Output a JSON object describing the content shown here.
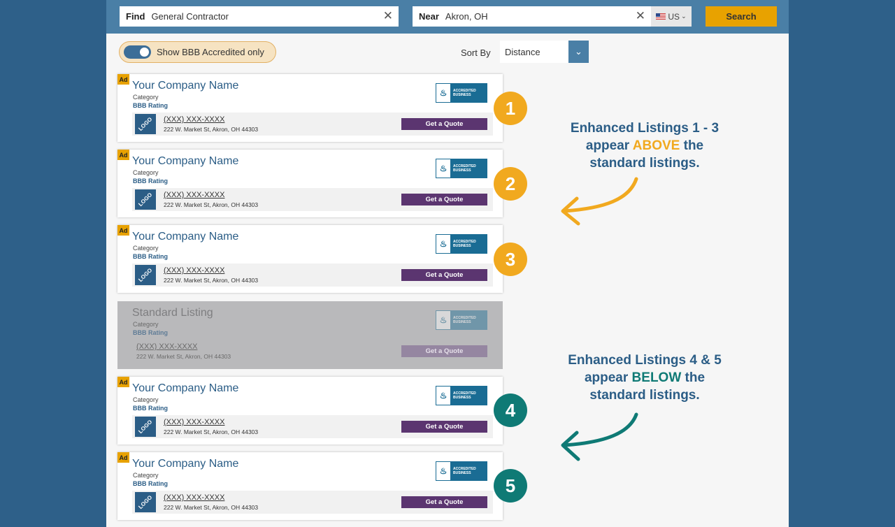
{
  "search": {
    "find_label": "Find",
    "find_value": "General Contractor",
    "near_label": "Near",
    "near_value": "Akron, OH",
    "country": "US",
    "search_button": "Search"
  },
  "filters": {
    "toggle_label": "Show BBB Accredited only",
    "toggle_on": true,
    "sort_label": "Sort By",
    "sort_value": "Distance"
  },
  "listings": [
    {
      "ad": "Ad",
      "name": "Your Company Name",
      "category": "Category",
      "rating": "BBB Rating",
      "phone": "(XXX) XXX-XXXX",
      "address": "222 W. Market St, Akron, OH 44303",
      "logo": "LOGO",
      "button": "Get a Quote",
      "number": "1"
    },
    {
      "ad": "Ad",
      "name": "Your Company Name",
      "category": "Category",
      "rating": "BBB Rating",
      "phone": "(XXX) XXX-XXXX",
      "address": "222 W. Market St, Akron, OH 44303",
      "logo": "LOGO",
      "button": "Get a Quote",
      "number": "2"
    },
    {
      "ad": "Ad",
      "name": "Your Company Name",
      "category": "Category",
      "rating": "BBB Rating",
      "phone": "(XXX) XXX-XXXX",
      "address": "222 W. Market St, Akron, OH 44303",
      "logo": "LOGO",
      "button": "Get a Quote",
      "number": "3"
    },
    {
      "name": "Standard Listing",
      "category": "Category",
      "rating": "BBB Rating",
      "phone": "(XXX) XXX-XXXX",
      "address": "222 W. Market St, Akron, OH 44303",
      "button": "Get a Quote"
    },
    {
      "ad": "Ad",
      "name": "Your Company Name",
      "category": "Category",
      "rating": "BBB Rating",
      "phone": "(XXX) XXX-XXXX",
      "address": "222 W. Market St, Akron, OH 44303",
      "logo": "LOGO",
      "button": "Get a Quote",
      "number": "4"
    },
    {
      "ad": "Ad",
      "name": "Your Company Name",
      "category": "Category",
      "rating": "BBB Rating",
      "phone": "(XXX) XXX-XXXX",
      "address": "222 W. Market St, Akron, OH 44303",
      "logo": "LOGO",
      "button": "Get a Quote",
      "number": "5"
    }
  ],
  "seal": {
    "line1": "ACCREDITED",
    "line2": "BUSINESS"
  },
  "callouts": {
    "top": {
      "line1": "Enhanced Listings 1 - 3",
      "line2_pre": "appear ",
      "line2_hl": "ABOVE",
      "line2_post": " the",
      "line3": "standard listings."
    },
    "bottom": {
      "line1": "Enhanced Listings 4 & 5",
      "line2_pre": "appear ",
      "line2_hl": "BELOW",
      "line2_post": " the",
      "line3": "standard listings."
    }
  },
  "colors": {
    "gold": "#f1a91f",
    "teal": "#0f7a75",
    "blue": "#2b5d86",
    "quote_purple": "#5b3570"
  },
  "icons": {
    "clear": "close-icon",
    "flag": "us-flag-icon",
    "caret": "chevron-down-icon",
    "seal": "bbb-accredited-seal-icon"
  }
}
